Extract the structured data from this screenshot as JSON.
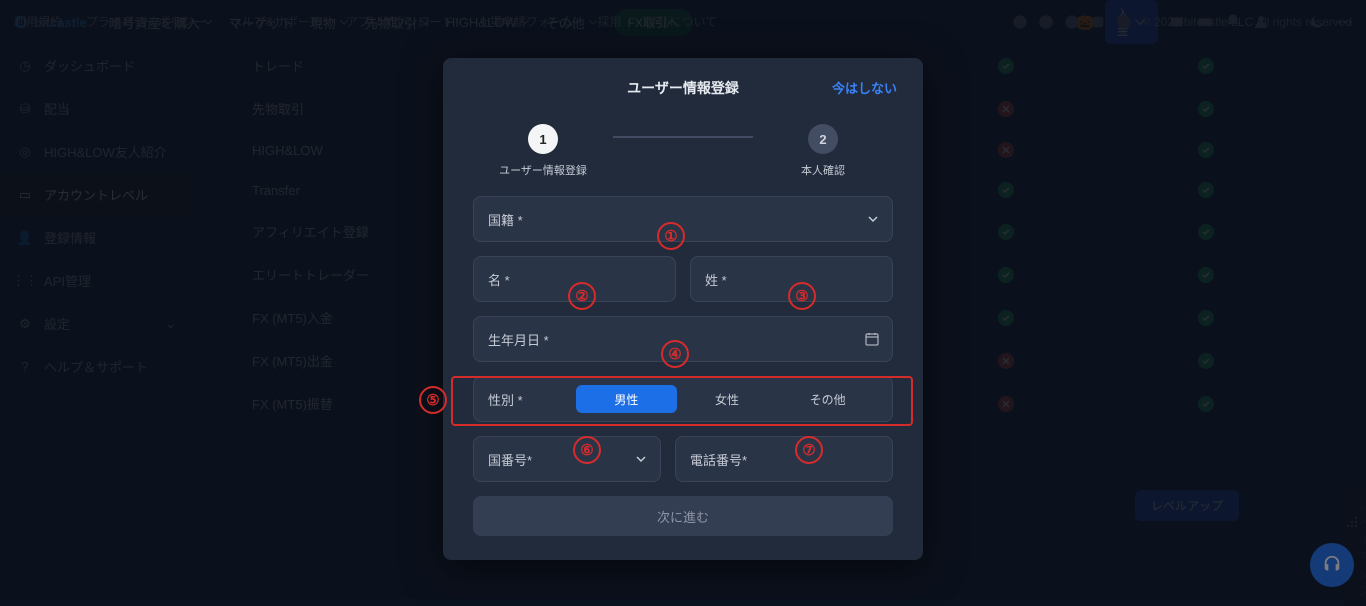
{
  "brand": "bitcastle",
  "nav": {
    "items": [
      "暗号資産を購入",
      "マーケット",
      "現物",
      "先物取引",
      "HIGH&LOW",
      "その他"
    ],
    "fx": "FX取引へ",
    "deposit": "入金"
  },
  "sidebar": {
    "items": [
      {
        "label": "ダッシュボード",
        "icon": "dashboard"
      },
      {
        "label": "配当",
        "icon": "payout"
      },
      {
        "label": "HIGH&LOW友人紹介",
        "icon": "target"
      },
      {
        "label": "アカウントレベル",
        "icon": "account",
        "active": true
      },
      {
        "label": "登録情報",
        "icon": "user"
      },
      {
        "label": "API管理",
        "icon": "api"
      },
      {
        "label": "設定",
        "icon": "gear",
        "chevron": true
      },
      {
        "label": "ヘルプ＆サポート",
        "icon": "help"
      }
    ]
  },
  "content_rows": [
    {
      "label": "トレード",
      "c1": "ok",
      "c2": "ok"
    },
    {
      "label": "先物取引",
      "c1": "no",
      "c2": "ok"
    },
    {
      "label": "HIGH&LOW",
      "c1": "no",
      "c2": "ok"
    },
    {
      "label": "Transfer",
      "c1": "ok",
      "c2": "ok"
    },
    {
      "label": "アフィリエイト登録",
      "c1": "ok",
      "c2": "ok"
    },
    {
      "label": "エリートトレーダー",
      "c1": "ok",
      "c2": "ok"
    },
    {
      "label": "FX (MT5)入金",
      "c1": "ok",
      "c2": "ok"
    },
    {
      "label": "FX (MT5)出金",
      "c1": "no",
      "c2": "ok"
    },
    {
      "label": "FX (MT5)振替",
      "c1": "no",
      "c2": "ok"
    }
  ],
  "level_buttons": {
    "active": "レベルアップ",
    "muted": "レベルアップ"
  },
  "footer": {
    "links": [
      "利用規約",
      "プライバシーポリシー",
      "ヘルプ&サポート",
      "アプリダウンロード",
      "上場申請フォーム",
      "採用",
      "弊社について"
    ],
    "copyright": "© 2023 bitcastle LLC All rights reserved"
  },
  "modal": {
    "title": "ユーザー情報登録",
    "skip": "今はしない",
    "step1_label": "ユーザー情報登録",
    "step2_label": "本人確認",
    "step1_num": "1",
    "step2_num": "2",
    "fields": {
      "country": "国籍 *",
      "first_name": "名 *",
      "last_name": "姓 *",
      "dob": "生年月日 *",
      "gender_label": "性別 *",
      "gender_male": "男性",
      "gender_female": "女性",
      "gender_other": "その他",
      "dial_code": "国番号*",
      "phone": "電話番号*"
    },
    "next": "次に進む",
    "annotations": [
      "①",
      "②",
      "③",
      "④",
      "⑤",
      "⑥",
      "⑦"
    ]
  }
}
